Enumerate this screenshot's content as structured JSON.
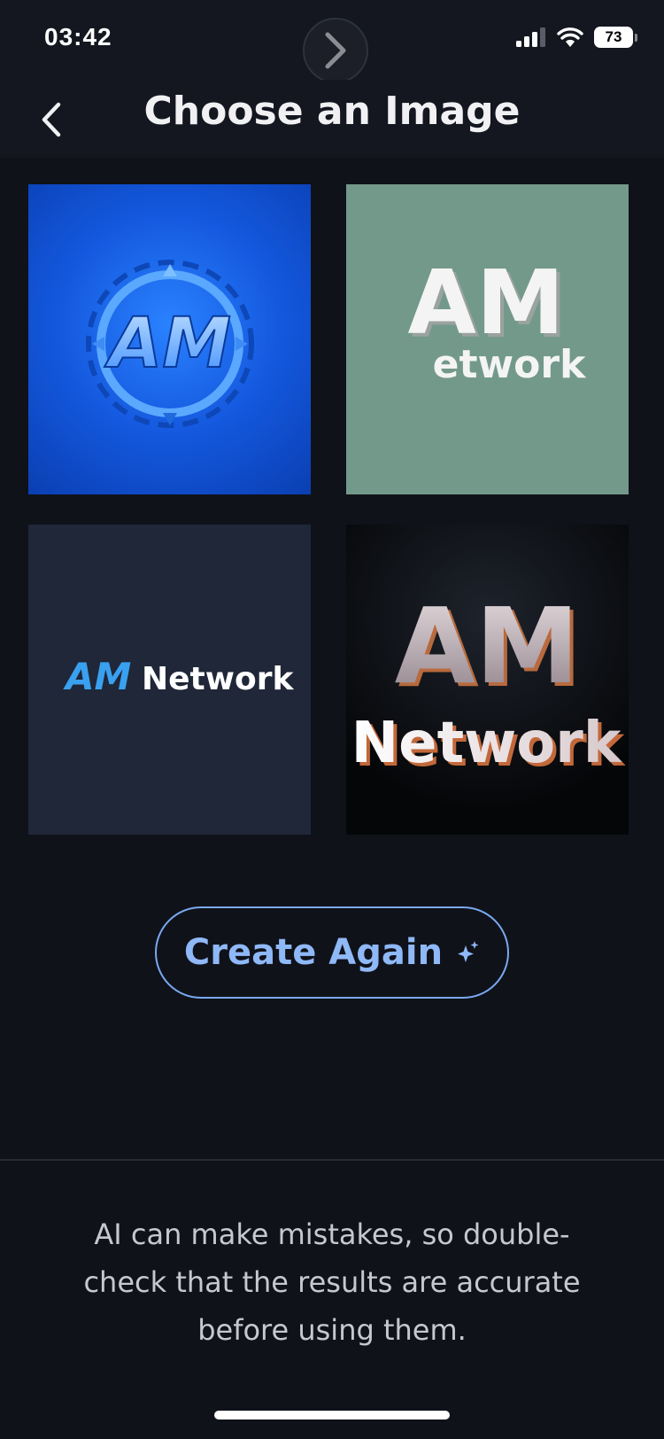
{
  "status_bar": {
    "time": "03:42",
    "battery": "73",
    "icons": [
      "cellular-signal-icon",
      "wifi-icon",
      "battery-icon"
    ]
  },
  "header": {
    "title": "Choose an Image",
    "back_icon": "chevron-left-icon"
  },
  "images": [
    {
      "label": "AM",
      "style": "blue emblem logo"
    },
    {
      "label": "AM",
      "label2": "etwork",
      "style": "white 3D text on sage"
    },
    {
      "label": "AM",
      "label2": "Network",
      "style": "flat text logo on navy"
    },
    {
      "label": "AM",
      "label2": "Network",
      "style": "metallic 3D text on black"
    }
  ],
  "actions": {
    "create_again": "Create Again",
    "create_again_icon": "sparkle-icon"
  },
  "disclaimer": "AI can make mistakes, so double-check that the results are accurate before using them.",
  "colors": {
    "background": "#10121a",
    "header": "#141720",
    "accent": "#8fb8f6"
  }
}
